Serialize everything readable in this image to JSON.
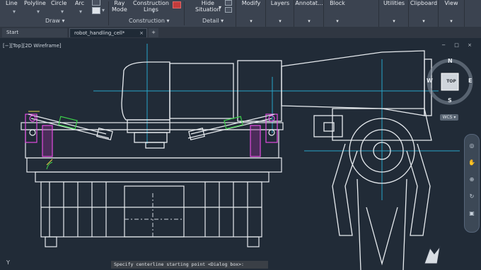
{
  "ribbon": {
    "draw_tools": [
      "Line",
      "Polyline",
      "Circle",
      "Arc"
    ],
    "draw_panel": "Draw",
    "ray_label": [
      "Ray",
      "Mode"
    ],
    "construction_label": [
      "Construction",
      "Lines"
    ],
    "construction_panel": "Construction",
    "hide_label": [
      "Hide",
      "Situation"
    ],
    "detail_panel": "Detail",
    "panels": [
      "Modify",
      "Layers",
      "Annotat...",
      "Block",
      "Utilities",
      "Clipboard",
      "View"
    ]
  },
  "tabs": {
    "start": "Start",
    "active": "robot_handling_cell*",
    "close": "×",
    "plus": "+"
  },
  "viewport": {
    "label": "[−][Top][2D Wireframe]",
    "controls": "− □ ×"
  },
  "viewcube": {
    "n": "N",
    "s": "S",
    "w": "W",
    "e": "E",
    "face": "TOP",
    "wcs": "WCS ▾"
  },
  "command_line": "Specify centerline starting point <Dialog box>:",
  "ucs_icon": "Y"
}
